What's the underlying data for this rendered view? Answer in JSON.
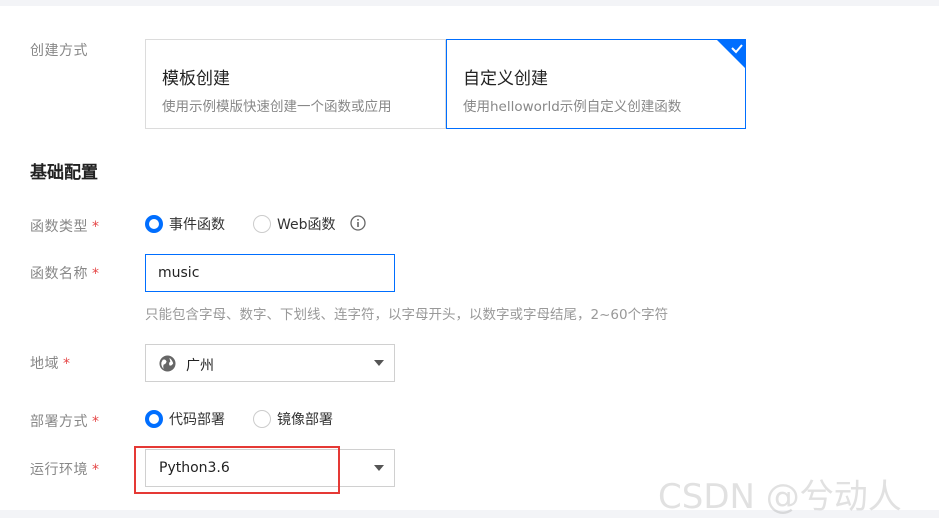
{
  "creation": {
    "label": "创建方式",
    "template_card": {
      "title": "模板创建",
      "desc": "使用示例模版快速创建一个函数或应用"
    },
    "custom_card": {
      "title": "自定义创建",
      "desc": "使用helloworld示例自定义创建函数",
      "selected": true
    }
  },
  "section": {
    "title": "基础配置"
  },
  "function_type": {
    "label": "函数类型",
    "required_mark": "*",
    "options": [
      "事件函数",
      "Web函数"
    ],
    "selected": "事件函数",
    "info_icon": "info-icon"
  },
  "function_name": {
    "label": "函数名称",
    "required_mark": "*",
    "value": "music",
    "hint": "只能包含字母、数字、下划线、连字符，以字母开头，以数字或字母结尾，2~60个字符"
  },
  "region": {
    "label": "地域",
    "required_mark": "*",
    "value": "广州",
    "icon": "globe-icon"
  },
  "deploy": {
    "label": "部署方式",
    "required_mark": "*",
    "options": [
      "代码部署",
      "镜像部署"
    ],
    "selected": "代码部署"
  },
  "runtime": {
    "label": "运行环境",
    "required_mark": "*",
    "value": "Python3.6"
  },
  "watermark": "CSDN @兮动人",
  "colors": {
    "accent": "#006eff",
    "required": "#e54545",
    "highlight_box": "#e53935"
  }
}
